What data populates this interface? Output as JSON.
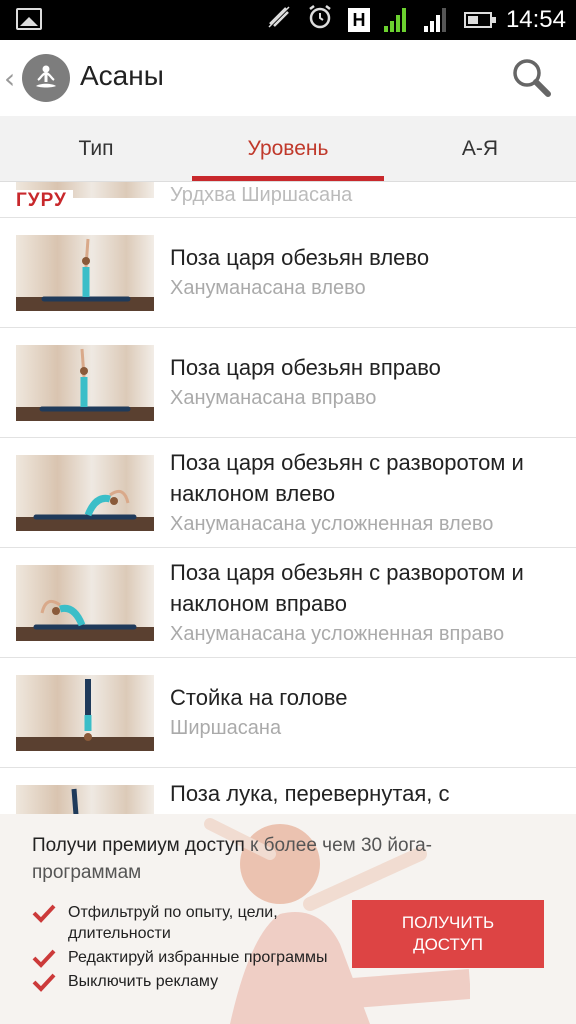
{
  "status_bar": {
    "time": "14:54",
    "h_label": "H",
    "icons": [
      "gallery-icon",
      "muted-icon",
      "alarm-icon",
      "signal-1-icon",
      "signal-2-icon",
      "battery-icon"
    ]
  },
  "header": {
    "title": "Асаны",
    "back_glyph": "‹"
  },
  "tabs": [
    {
      "label": "Тип",
      "active": false
    },
    {
      "label": "Уровень",
      "active": true
    },
    {
      "label": "А-Я",
      "active": false
    }
  ],
  "list": {
    "partial_subtitle": "Урдхва Ширшасана",
    "section_label": "ГУРУ",
    "items": [
      {
        "title": "Поза царя обезьян влево",
        "subtitle": "Хануманасана влево"
      },
      {
        "title": "Поза царя обезьян вправо",
        "subtitle": "Хануманасана вправо"
      },
      {
        "title": "Поза царя обезьян с разворотом и наклоном влево",
        "subtitle": "Хануманасана усложненная влево"
      },
      {
        "title": "Поза царя обезьян с разворотом и наклоном вправо",
        "subtitle": "Хануманасана усложненная вправо"
      },
      {
        "title": "Стойка на голове",
        "subtitle": "Ширшасана"
      },
      {
        "title": "Поза лука, перевернутая, с",
        "subtitle": ""
      }
    ]
  },
  "promo": {
    "headline_strong": "Получи премиум доступ",
    "headline_light": " к более чем 30 йога-программам",
    "benefits": [
      "Отфильтруй по опыту, цели, длительности",
      "Редактируй избранные программы",
      "Выключить рекламу"
    ],
    "cta_label": "ПОЛУЧИТЬ ДОСТУП"
  },
  "colors": {
    "accent": "#c8282c",
    "cta": "#dd4444",
    "subtitle": "#aaaaaa"
  }
}
